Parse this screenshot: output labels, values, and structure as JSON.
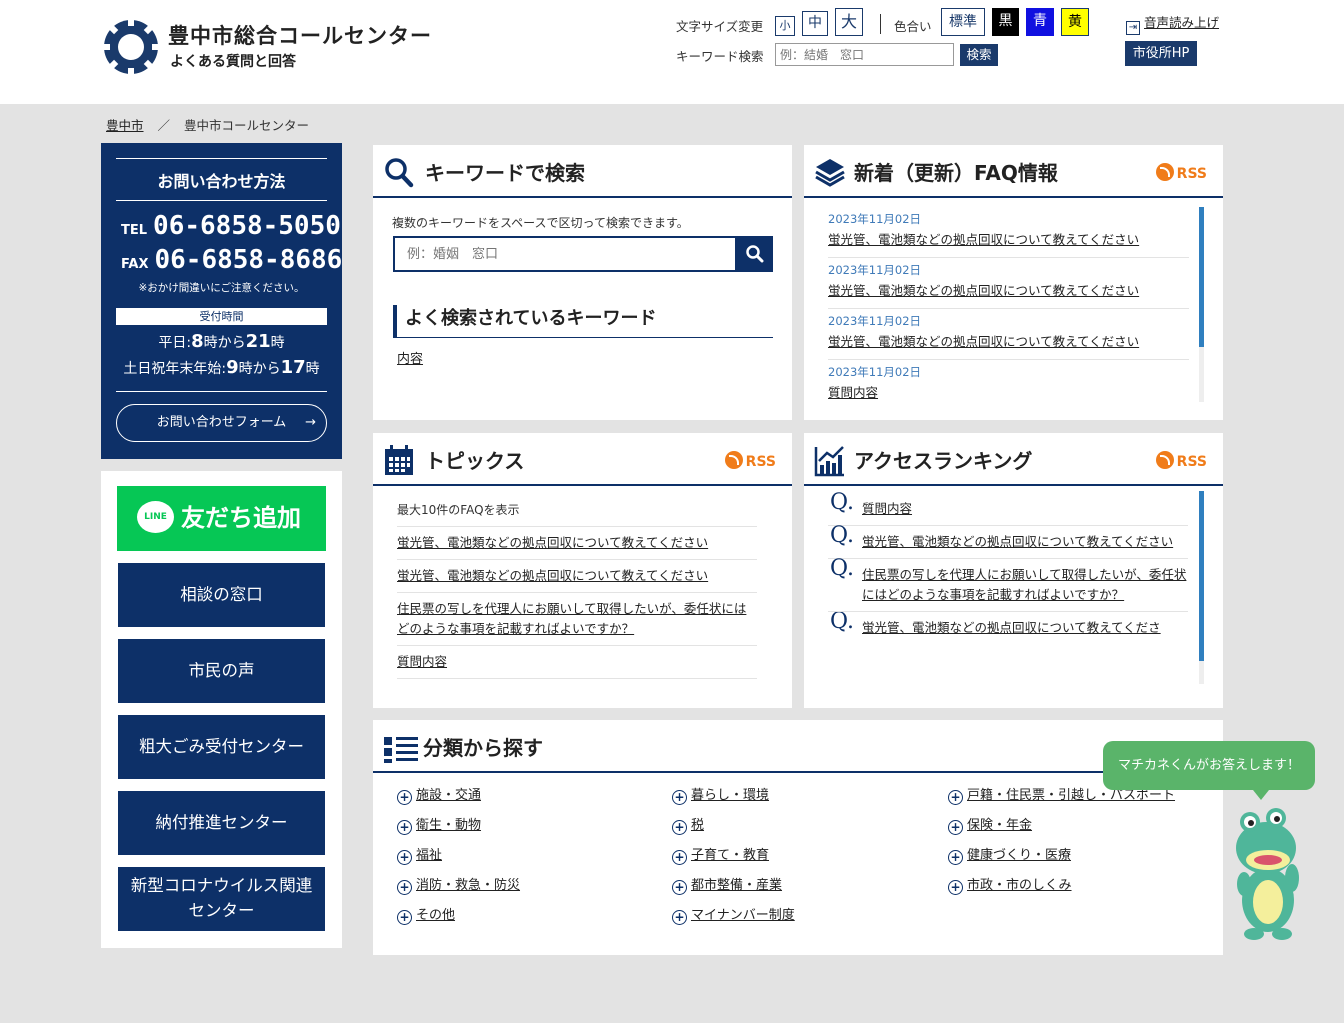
{
  "header": {
    "title": "豊中市総合コールセンター",
    "subtitle": "よくある質問と回答",
    "font_size_label": "文字サイズ変更",
    "font_sizes": [
      "小",
      "中",
      "大"
    ],
    "color_label": "色合い",
    "color_options": [
      {
        "label": "標準",
        "bg": "#ffffff",
        "fg": "#1a3a6b"
      },
      {
        "label": "黒",
        "bg": "#000000",
        "fg": "#ffffff"
      },
      {
        "label": "青",
        "bg": "#1010e0",
        "fg": "#ffffff"
      },
      {
        "label": "黄",
        "bg": "#ffff00",
        "fg": "#000000"
      }
    ],
    "keyword_label": "キーワード検索",
    "keyword_placeholder": "例：結婚　窓口",
    "search_button": "検索",
    "voice_label": "音声読み上げ",
    "city_hp": "市役所HP"
  },
  "breadcrumb": {
    "home": "豊中市",
    "separator": "／",
    "current": "豊中市コールセンター"
  },
  "contact": {
    "title": "お問い合わせ方法",
    "tel_label": "TEL",
    "tel": "06-6858-5050",
    "fax_label": "FAX",
    "fax": "06-6858-8686",
    "note": "※おかけ間違いにご注意ください。",
    "hours_label": "受付時間",
    "weekday_prefix": "平日:",
    "weekday_start": "8",
    "weekday_mid": "時から",
    "weekday_end": "21",
    "weekday_suffix": "時",
    "holiday_prefix": "土日祝年末年始:",
    "holiday_start": "9",
    "holiday_mid": "時から",
    "holiday_end": "17",
    "holiday_suffix": "時",
    "form_button": "お問い合わせフォーム",
    "form_arrow": "→"
  },
  "sidebar": {
    "line_button": "友だち追加",
    "line_icon_text": "LINE",
    "buttons": [
      "相談の窓口",
      "市民の声",
      "粗大ごみ受付センター",
      "納付推進センター",
      "新型コロナウイルス関連センター"
    ]
  },
  "keyword_panel": {
    "title": "キーワードで検索",
    "description": "複数のキーワードをスペースで区切って検索できます。",
    "placeholder": "例：婚姻　窓口",
    "popular_title": "よく検索されているキーワード",
    "popular_keywords": [
      "内容"
    ]
  },
  "news_panel": {
    "title": "新着（更新）FAQ情報",
    "rss": "RSS",
    "items": [
      {
        "date": "2023年11月02日",
        "title": "蛍光管、電池類などの拠点回収について教えてください"
      },
      {
        "date": "2023年11月02日",
        "title": "蛍光管、電池類などの拠点回収について教えてください"
      },
      {
        "date": "2023年11月02日",
        "title": "蛍光管、電池類などの拠点回収について教えてください"
      },
      {
        "date": "2023年11月02日",
        "title": "質問内容"
      }
    ]
  },
  "topics_panel": {
    "title": "トピックス",
    "rss": "RSS",
    "intro": "最大10件のFAQを表示",
    "items": [
      "蛍光管、電池類などの拠点回収について教えてください",
      "蛍光管、電池類などの拠点回収について教えてください",
      "住民票の写しを代理人にお願いして取得したいが、委任状にはどのような事項を記載すればよいですか？",
      "質問内容"
    ]
  },
  "ranking_panel": {
    "title": "アクセスランキング",
    "rss": "RSS",
    "q_mark": "Q.",
    "items": [
      "質問内容",
      "蛍光管、電池類などの拠点回収について教えてください",
      "住民票の写しを代理人にお願いして取得したいが、委任状にはどのような事項を記載すればよいですか？",
      "蛍光管、電池類などの拠点回収について教えてくださ"
    ]
  },
  "category_panel": {
    "title": "分類から探す",
    "col1": [
      "施設・交通",
      "衛生・動物",
      "福祉",
      "消防・救急・防災",
      "その他"
    ],
    "col2": [
      "暮らし・環境",
      "税",
      "子育て・教育",
      "都市整備・産業",
      "マイナンバー制度"
    ],
    "col3": [
      "戸籍・住民票・引越し・パスポート",
      "保険・年金",
      "健康づくり・医療",
      "市政・市のしくみ"
    ]
  },
  "chatbot": {
    "bubble": "マチカネくんがお答えします！"
  },
  "colors": {
    "navy": "#0d3068",
    "line_green": "#06c755",
    "rss_orange": "#f07c1a",
    "bubble_green": "#5ab46a"
  }
}
